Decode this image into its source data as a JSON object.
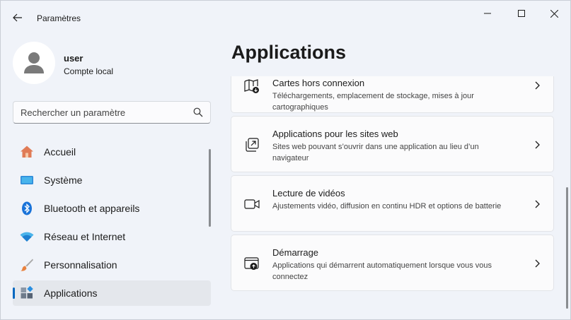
{
  "window": {
    "title": "Paramètres"
  },
  "profile": {
    "name": "user",
    "account_type": "Compte local"
  },
  "search": {
    "placeholder": "Rechercher un paramètre",
    "value": ""
  },
  "sidebar": {
    "items": [
      {
        "label": "Accueil",
        "icon": "home-icon",
        "active": false
      },
      {
        "label": "Système",
        "icon": "system-icon",
        "active": false
      },
      {
        "label": "Bluetooth et appareils",
        "icon": "bluetooth-icon",
        "active": false
      },
      {
        "label": "Réseau et Internet",
        "icon": "wifi-icon",
        "active": false
      },
      {
        "label": "Personnalisation",
        "icon": "brush-icon",
        "active": false
      },
      {
        "label": "Applications",
        "icon": "apps-icon",
        "active": true
      }
    ]
  },
  "main": {
    "title": "Applications",
    "cards": [
      {
        "title": "Cartes hors connexion",
        "description": "Téléchargements, emplacement de stockage, mises à jour cartographiques",
        "icon": "offline-maps-icon"
      },
      {
        "title": "Applications pour les sites web",
        "description": "Sites web pouvant s’ouvrir dans une application au lieu d’un navigateur",
        "icon": "apps-for-websites-icon"
      },
      {
        "title": "Lecture de vidéos",
        "description": "Ajustements vidéo, diffusion en continu HDR et options de batterie",
        "icon": "video-playback-icon"
      },
      {
        "title": "Démarrage",
        "description": "Applications qui démarrent automatiquement lorsque vous vous connectez",
        "icon": "startup-icon"
      }
    ]
  },
  "colors": {
    "accent": "#0067c0",
    "background": "#f0f3f9",
    "card": "#fbfbfc"
  }
}
